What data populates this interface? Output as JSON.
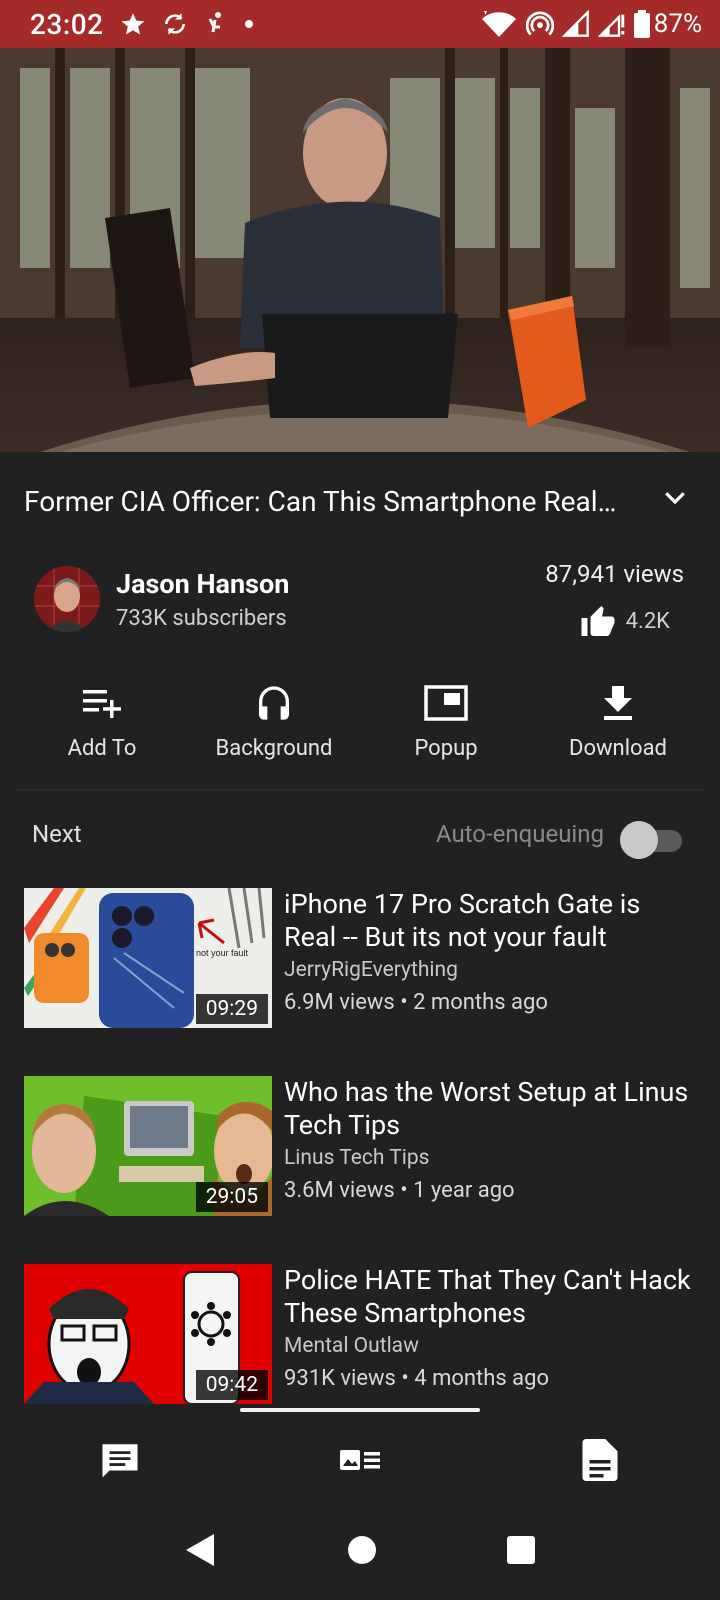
{
  "status_bar": {
    "time": "23:02",
    "battery": "87%"
  },
  "video": {
    "title": "Former CIA Officer: Can This Smartphone Real…"
  },
  "channel": {
    "name": "Jason Hanson",
    "subscribers": "733K subscribers",
    "views": "87,941 views",
    "likes": "4.2K"
  },
  "actions": [
    {
      "label": "Add To",
      "icon": "playlist-add-icon"
    },
    {
      "label": "Background",
      "icon": "headphones-icon"
    },
    {
      "label": "Popup",
      "icon": "popup-window-icon"
    },
    {
      "label": "Download",
      "icon": "download-icon"
    }
  ],
  "next_section": {
    "label": "Next",
    "auto_enqueue_label": "Auto-enqueuing",
    "auto_enqueue_on": false
  },
  "related": [
    {
      "title": "iPhone 17 Pro Scratch Gate is Real -- But its not your fault",
      "channel": "JerryRigEverything",
      "stats": "6.9M views • 2 months ago",
      "duration": "09:29",
      "thumb_caption": "not your fault"
    },
    {
      "title": "Who has the Worst Setup at Linus Tech Tips",
      "channel": "Linus Tech Tips",
      "stats": "3.6M views • 1 year ago",
      "duration": "29:05"
    },
    {
      "title": "Police HATE That They Can't Hack These Smartphones",
      "channel": "Mental Outlaw",
      "stats": "931K views • 4 months ago",
      "duration": "09:42"
    }
  ],
  "bottom_tabs": [
    "comments-icon",
    "related-videos-icon",
    "description-icon"
  ],
  "colors": {
    "status_bar": "#a52a2a",
    "background": "#212121"
  }
}
